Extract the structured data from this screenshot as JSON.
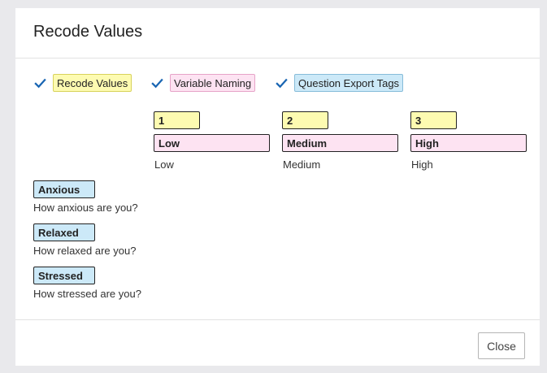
{
  "dialog": {
    "title": "Recode Values",
    "close_label": "Close"
  },
  "options": [
    {
      "label": "Recode Values",
      "checked": true,
      "color": "#fdfbb1"
    },
    {
      "label": "Variable Naming",
      "checked": true,
      "color": "#fde3f2"
    },
    {
      "label": "Question Export Tags",
      "checked": true,
      "color": "#cce9f8"
    }
  ],
  "choices": [
    {
      "recode": "1",
      "variable_name": "Low",
      "text": "Low"
    },
    {
      "recode": "2",
      "variable_name": "Medium",
      "text": "Medium"
    },
    {
      "recode": "3",
      "variable_name": "High",
      "text": "High"
    }
  ],
  "statements": [
    {
      "tag": "Anxious",
      "text": "How anxious are you?"
    },
    {
      "tag": "Relaxed",
      "text": "How relaxed are you?"
    },
    {
      "tag": "Stressed",
      "text": "How stressed are you?"
    }
  ],
  "colors": {
    "checkmark": "#1a66b3",
    "recode_highlight": "#fdfbb1",
    "naming_highlight": "#fde3f2",
    "export_tag_highlight": "#cce9f8"
  }
}
